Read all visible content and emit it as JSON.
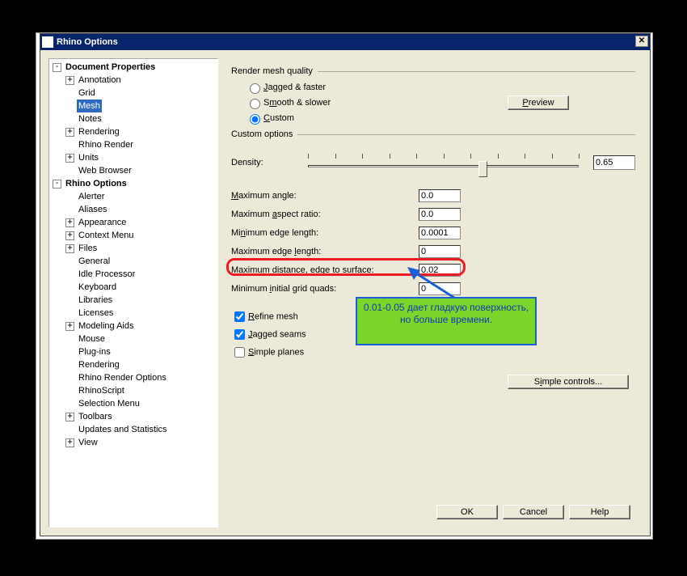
{
  "dialog": {
    "title": "Rhino Options",
    "close_glyph": "✕"
  },
  "tree": {
    "root1": "Document Properties",
    "root1_items": {
      "annotation": "Annotation",
      "grid": "Grid",
      "mesh": "Mesh",
      "notes": "Notes",
      "rendering": "Rendering",
      "rhino_render": "Rhino Render",
      "units": "Units",
      "web_browser": "Web Browser"
    },
    "root2": "Rhino Options",
    "root2_items": {
      "alerter": "Alerter",
      "aliases": "Aliases",
      "appearance": "Appearance",
      "context_menu": "Context Menu",
      "files": "Files",
      "general": "General",
      "idle_processor": "Idle Processor",
      "keyboard": "Keyboard",
      "libraries": "Libraries",
      "licenses": "Licenses",
      "modeling_aids": "Modeling Aids",
      "mouse": "Mouse",
      "plugins": "Plug-ins",
      "rendering": "Rendering",
      "rhino_render_options": "Rhino Render Options",
      "rhinoscript": "RhinoScript",
      "selection_menu": "Selection Menu",
      "toolbars": "Toolbars",
      "updates": "Updates and Statistics",
      "view": "View"
    }
  },
  "panel": {
    "render_mesh_quality": "Render mesh quality",
    "radio_jagged": "Jagged & faster",
    "radio_smooth": "Smooth & slower",
    "radio_custom": "Custom",
    "preview_btn": "Preview",
    "custom_options": "Custom options",
    "density_label": "Density:",
    "density_value": "0.65",
    "max_angle_label": "Maximum angle:",
    "max_angle_value": "0.0",
    "max_aspect_label": "Maximum aspect ratio:",
    "max_aspect_value": "0.0",
    "min_edge_label": "Minimum edge length:",
    "min_edge_value": "0.0001",
    "max_edge_label": "Maximum edge length:",
    "max_edge_value": "0",
    "max_dist_label": "Maximum distance, edge to surface:",
    "max_dist_value": "0.02",
    "min_grid_label": "Minimum initial grid quads:",
    "min_grid_value": "0",
    "refine_mesh": "Refine mesh",
    "jagged_seams": "Jagged seams",
    "simple_planes": "Simple planes",
    "simple_controls_btn": "Simple controls...",
    "ok": "OK",
    "cancel": "Cancel",
    "help": "Help"
  },
  "callout": {
    "text": "0.01-0.05 дает гладкую поверхность, но больше времени."
  }
}
